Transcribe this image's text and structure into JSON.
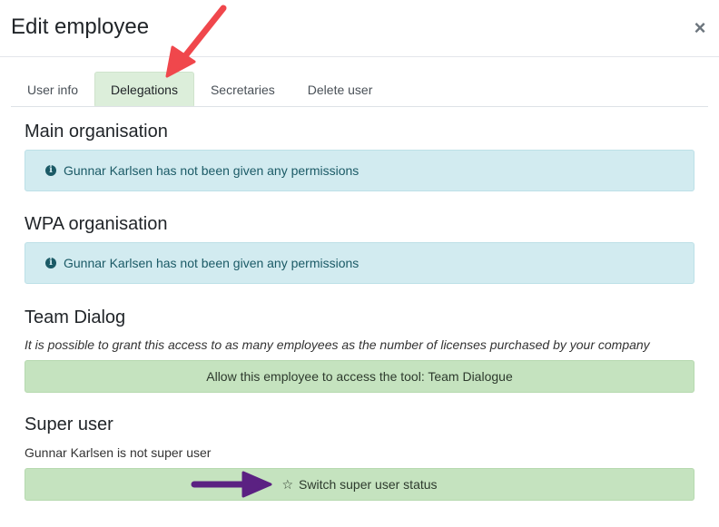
{
  "modal": {
    "title": "Edit employee",
    "close_glyph": "×"
  },
  "tabs": [
    {
      "label": "User info",
      "active": false
    },
    {
      "label": "Delegations",
      "active": true
    },
    {
      "label": "Secretaries",
      "active": false
    },
    {
      "label": "Delete user",
      "active": false
    }
  ],
  "sections": {
    "main_org": {
      "title": "Main organisation",
      "alert": "Gunnar Karlsen has not been given any permissions",
      "icon": "info-circle-icon"
    },
    "wpa_org": {
      "title": "WPA organisation",
      "alert": "Gunnar Karlsen has not been given any permissions",
      "icon": "info-circle-icon"
    },
    "team_dialog": {
      "title": "Team Dialog",
      "note": "It is possible to grant this access to as many employees as the number of licenses purchased by your company",
      "button": "Allow this employee to access the tool: Team Dialogue"
    },
    "super_user": {
      "title": "Super user",
      "status": "Gunnar Karlsen is not super user",
      "button": "Switch super user status",
      "icon": "star-outline-icon"
    }
  },
  "colors": {
    "active_tab": "#dceeda",
    "info_alert": "#d2ebf0",
    "action_button": "#c5e3bf",
    "annotation_red_arrow": "#f0474c",
    "annotation_purple_arrow": "#5b2182"
  }
}
